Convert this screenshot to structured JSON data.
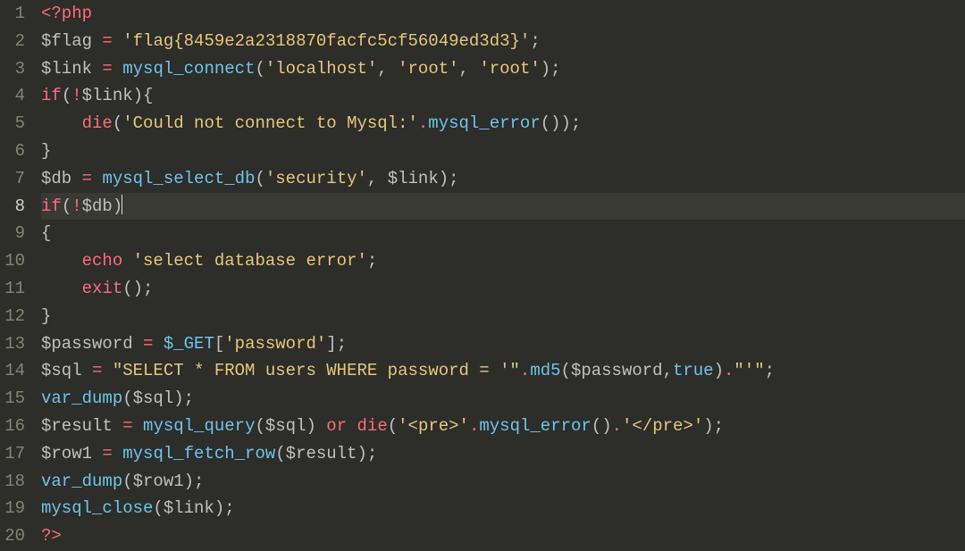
{
  "editor": {
    "activeLine": 8,
    "totalLines": 20,
    "lines": [
      {
        "n": 1,
        "tokens": [
          {
            "t": "<?php",
            "c": "tok-open"
          }
        ]
      },
      {
        "n": 2,
        "tokens": [
          {
            "t": "$flag",
            "c": "tok-var"
          },
          {
            "t": " ",
            "c": "tok-punct"
          },
          {
            "t": "=",
            "c": "tok-op"
          },
          {
            "t": " ",
            "c": "tok-punct"
          },
          {
            "t": "'flag{8459e2a2318870facfc5cf56049ed3d3}'",
            "c": "tok-str"
          },
          {
            "t": ";",
            "c": "tok-punct"
          }
        ]
      },
      {
        "n": 3,
        "tokens": [
          {
            "t": "$link",
            "c": "tok-var"
          },
          {
            "t": " ",
            "c": "tok-punct"
          },
          {
            "t": "=",
            "c": "tok-op"
          },
          {
            "t": " ",
            "c": "tok-punct"
          },
          {
            "t": "mysql_connect",
            "c": "tok-func"
          },
          {
            "t": "(",
            "c": "tok-punct"
          },
          {
            "t": "'localhost'",
            "c": "tok-str"
          },
          {
            "t": ", ",
            "c": "tok-punct"
          },
          {
            "t": "'root'",
            "c": "tok-str"
          },
          {
            "t": ", ",
            "c": "tok-punct"
          },
          {
            "t": "'root'",
            "c": "tok-str"
          },
          {
            "t": ");",
            "c": "tok-punct"
          }
        ]
      },
      {
        "n": 4,
        "tokens": [
          {
            "t": "if",
            "c": "tok-kw"
          },
          {
            "t": "(",
            "c": "tok-punct"
          },
          {
            "t": "!",
            "c": "tok-op"
          },
          {
            "t": "$link",
            "c": "tok-var"
          },
          {
            "t": "){",
            "c": "tok-punct"
          }
        ]
      },
      {
        "n": 5,
        "tokens": [
          {
            "t": "    ",
            "c": "tok-punct"
          },
          {
            "t": "die",
            "c": "tok-kw"
          },
          {
            "t": "(",
            "c": "tok-punct"
          },
          {
            "t": "'Could not connect to Mysql:'",
            "c": "tok-str"
          },
          {
            "t": ".",
            "c": "tok-op"
          },
          {
            "t": "mysql_error",
            "c": "tok-func"
          },
          {
            "t": "());",
            "c": "tok-punct"
          }
        ]
      },
      {
        "n": 6,
        "tokens": [
          {
            "t": "}",
            "c": "tok-punct"
          }
        ]
      },
      {
        "n": 7,
        "tokens": [
          {
            "t": "$db",
            "c": "tok-var"
          },
          {
            "t": " ",
            "c": "tok-punct"
          },
          {
            "t": "=",
            "c": "tok-op"
          },
          {
            "t": " ",
            "c": "tok-punct"
          },
          {
            "t": "mysql_select_db",
            "c": "tok-func"
          },
          {
            "t": "(",
            "c": "tok-punct"
          },
          {
            "t": "'security'",
            "c": "tok-str"
          },
          {
            "t": ", ",
            "c": "tok-punct"
          },
          {
            "t": "$link",
            "c": "tok-var"
          },
          {
            "t": ");",
            "c": "tok-punct"
          }
        ]
      },
      {
        "n": 8,
        "active": true,
        "tokens": [
          {
            "t": "if",
            "c": "tok-kw"
          },
          {
            "t": "(",
            "c": "tok-punct"
          },
          {
            "t": "!",
            "c": "tok-op"
          },
          {
            "t": "$db",
            "c": "tok-var"
          },
          {
            "t": ")",
            "c": "tok-punct"
          },
          {
            "t": "|",
            "c": "cursor"
          }
        ]
      },
      {
        "n": 9,
        "tokens": [
          {
            "t": "{",
            "c": "tok-punct"
          }
        ]
      },
      {
        "n": 10,
        "tokens": [
          {
            "t": "    ",
            "c": "tok-punct"
          },
          {
            "t": "echo",
            "c": "tok-kw"
          },
          {
            "t": " ",
            "c": "tok-punct"
          },
          {
            "t": "'select database error'",
            "c": "tok-str"
          },
          {
            "t": ";",
            "c": "tok-punct"
          }
        ]
      },
      {
        "n": 11,
        "tokens": [
          {
            "t": "    ",
            "c": "tok-punct"
          },
          {
            "t": "exit",
            "c": "tok-kw"
          },
          {
            "t": "();",
            "c": "tok-punct"
          }
        ]
      },
      {
        "n": 12,
        "tokens": [
          {
            "t": "}",
            "c": "tok-punct"
          }
        ]
      },
      {
        "n": 13,
        "tokens": [
          {
            "t": "$password",
            "c": "tok-var"
          },
          {
            "t": " ",
            "c": "tok-punct"
          },
          {
            "t": "=",
            "c": "tok-op"
          },
          {
            "t": " ",
            "c": "tok-punct"
          },
          {
            "t": "$_GET",
            "c": "tok-global"
          },
          {
            "t": "[",
            "c": "tok-punct"
          },
          {
            "t": "'password'",
            "c": "tok-str"
          },
          {
            "t": "];",
            "c": "tok-punct"
          }
        ]
      },
      {
        "n": 14,
        "tokens": [
          {
            "t": "$sql",
            "c": "tok-var"
          },
          {
            "t": " ",
            "c": "tok-punct"
          },
          {
            "t": "=",
            "c": "tok-op"
          },
          {
            "t": " ",
            "c": "tok-punct"
          },
          {
            "t": "\"SELECT * FROM users WHERE password = '\"",
            "c": "tok-str"
          },
          {
            "t": ".",
            "c": "tok-op"
          },
          {
            "t": "md5",
            "c": "tok-func"
          },
          {
            "t": "(",
            "c": "tok-punct"
          },
          {
            "t": "$password",
            "c": "tok-var"
          },
          {
            "t": ",",
            "c": "tok-punct"
          },
          {
            "t": "true",
            "c": "tok-const"
          },
          {
            "t": ")",
            "c": "tok-punct"
          },
          {
            "t": ".",
            "c": "tok-op"
          },
          {
            "t": "\"'\"",
            "c": "tok-str"
          },
          {
            "t": ";",
            "c": "tok-punct"
          }
        ]
      },
      {
        "n": 15,
        "tokens": [
          {
            "t": "var_dump",
            "c": "tok-func"
          },
          {
            "t": "(",
            "c": "tok-punct"
          },
          {
            "t": "$sql",
            "c": "tok-var"
          },
          {
            "t": ");",
            "c": "tok-punct"
          }
        ]
      },
      {
        "n": 16,
        "tokens": [
          {
            "t": "$result",
            "c": "tok-var"
          },
          {
            "t": " ",
            "c": "tok-punct"
          },
          {
            "t": "=",
            "c": "tok-op"
          },
          {
            "t": " ",
            "c": "tok-punct"
          },
          {
            "t": "mysql_query",
            "c": "tok-func"
          },
          {
            "t": "(",
            "c": "tok-punct"
          },
          {
            "t": "$sql",
            "c": "tok-var"
          },
          {
            "t": ") ",
            "c": "tok-punct"
          },
          {
            "t": "or",
            "c": "tok-op"
          },
          {
            "t": " ",
            "c": "tok-punct"
          },
          {
            "t": "die",
            "c": "tok-kw"
          },
          {
            "t": "(",
            "c": "tok-punct"
          },
          {
            "t": "'<pre>'",
            "c": "tok-str"
          },
          {
            "t": ".",
            "c": "tok-op"
          },
          {
            "t": "mysql_error",
            "c": "tok-func"
          },
          {
            "t": "()",
            "c": "tok-punct"
          },
          {
            "t": ".",
            "c": "tok-op"
          },
          {
            "t": "'</pre>'",
            "c": "tok-str"
          },
          {
            "t": ");",
            "c": "tok-punct"
          }
        ]
      },
      {
        "n": 17,
        "tokens": [
          {
            "t": "$row1",
            "c": "tok-var"
          },
          {
            "t": " ",
            "c": "tok-punct"
          },
          {
            "t": "=",
            "c": "tok-op"
          },
          {
            "t": " ",
            "c": "tok-punct"
          },
          {
            "t": "mysql_fetch_row",
            "c": "tok-func"
          },
          {
            "t": "(",
            "c": "tok-punct"
          },
          {
            "t": "$result",
            "c": "tok-var"
          },
          {
            "t": ");",
            "c": "tok-punct"
          }
        ]
      },
      {
        "n": 18,
        "tokens": [
          {
            "t": "var_dump",
            "c": "tok-func"
          },
          {
            "t": "(",
            "c": "tok-punct"
          },
          {
            "t": "$row1",
            "c": "tok-var"
          },
          {
            "t": ");",
            "c": "tok-punct"
          }
        ]
      },
      {
        "n": 19,
        "tokens": [
          {
            "t": "mysql_close",
            "c": "tok-func"
          },
          {
            "t": "(",
            "c": "tok-punct"
          },
          {
            "t": "$link",
            "c": "tok-var"
          },
          {
            "t": ");",
            "c": "tok-punct"
          }
        ]
      },
      {
        "n": 20,
        "tokens": [
          {
            "t": "?>",
            "c": "tok-open"
          }
        ]
      }
    ]
  }
}
